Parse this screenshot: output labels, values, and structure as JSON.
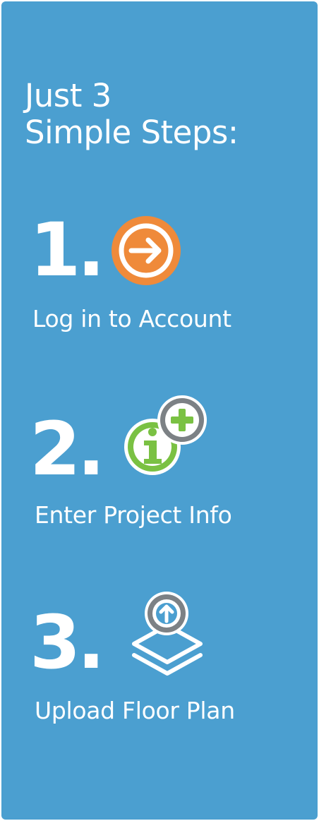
{
  "heading": {
    "line1": "Just 3",
    "line2": "Simple Steps:"
  },
  "steps": [
    {
      "number": "1.",
      "label": "Log in to Account",
      "icon": "arrow-right-circle-icon"
    },
    {
      "number": "2.",
      "label": "Enter Project Info",
      "icon": "info-plus-icon"
    },
    {
      "number": "3.",
      "label": "Upload Floor Plan",
      "icon": "upload-layers-icon"
    }
  ],
  "colors": {
    "panel_background": "#4b9fd0",
    "text": "#ffffff",
    "orange_accent": "#ef8a3a",
    "green_accent": "#7ac143",
    "gray_accent": "#7c8185"
  }
}
